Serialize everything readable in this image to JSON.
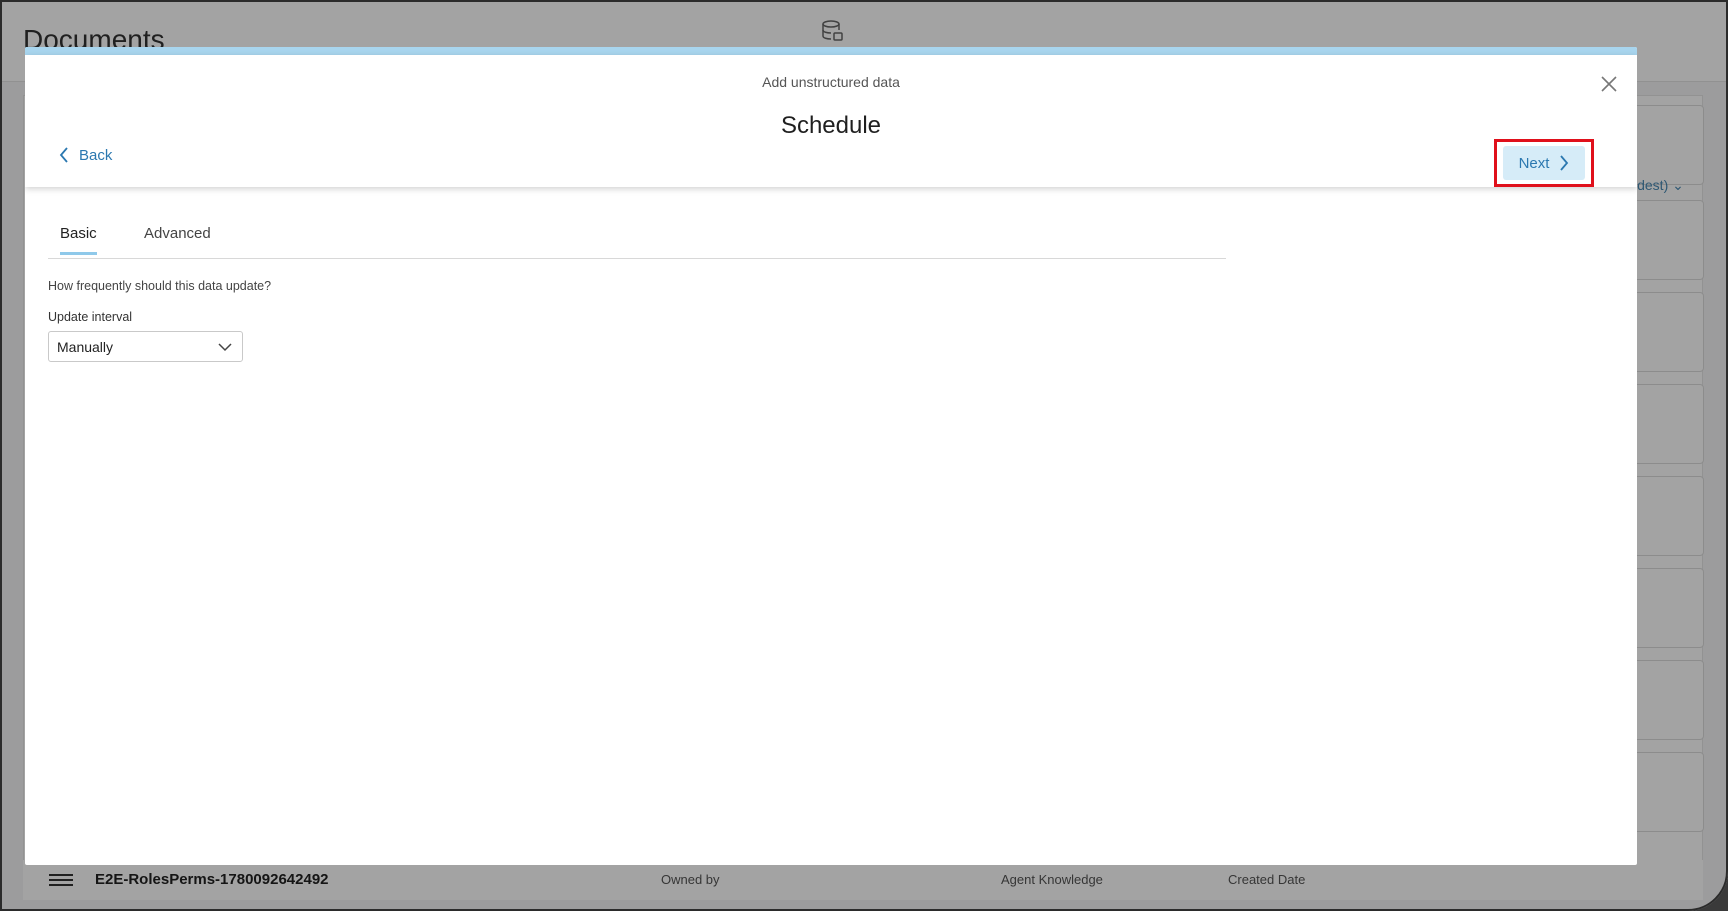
{
  "background": {
    "page_title": "Documents",
    "sort_label": "ldest)",
    "row": {
      "name": "E2E-RolesPerms-1780092642492",
      "owned_by_label": "Owned by",
      "agent_knowledge_label": "Agent Knowledge",
      "created_date_label": "Created Date"
    }
  },
  "modal": {
    "subtitle": "Add unstructured data",
    "title": "Schedule",
    "back_label": "Back",
    "next_label": "Next",
    "tabs": [
      {
        "label": "Basic",
        "active": true
      },
      {
        "label": "Advanced",
        "active": false
      }
    ],
    "question": "How frequently should this data update?",
    "update_interval": {
      "label": "Update interval",
      "value": "Manually"
    }
  },
  "colors": {
    "accent": "#2b78b0",
    "highlight": "#e0101b",
    "tab_underline": "#8fc9ea",
    "topbar": "#a8d5ee"
  },
  "icons": {
    "header": "database-icon",
    "close": "close-icon",
    "back": "chevron-left-icon",
    "next": "chevron-right-icon",
    "select": "chevron-down-icon"
  }
}
